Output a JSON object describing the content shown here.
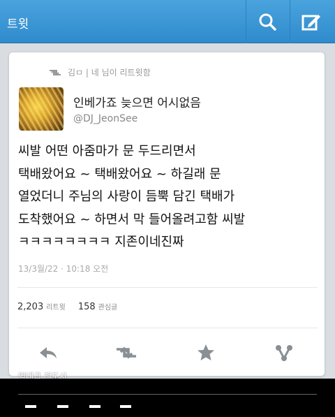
{
  "header": {
    "title": "트윗",
    "search_icon": "search-icon",
    "compose_icon": "compose-icon"
  },
  "tweet": {
    "retweeted_by": "김ㅁ | 네 님이 리트윗함",
    "author": {
      "name": "인베가죠 늦으면 어시없음",
      "handle": "@DJ_JeonSee"
    },
    "text": "씨발 어떤 아줌마가 문 두드리면서\n택배왔어요 ~ 택배왔어요 ~ 하길래 문\n열었더니 주님의 사랑이 듬뿍 담긴 택배가\n도착했어요 ~ 하면서 막 들어올려고함 씨발\nㅋㅋㅋㅋㅋㅋㅋㅋ 지존이네진짜",
    "timestamp": "13/3월/22 · 10:18 오전",
    "retweets": {
      "count": "2,203",
      "label": "리트윗"
    },
    "favorites": {
      "count": "158",
      "label": "관심글"
    }
  },
  "actions": {
    "reply_icon": "reply-icon",
    "retweet_icon": "retweet-icon",
    "favorite_icon": "star-icon",
    "share_icon": "share-icon"
  },
  "watermark": "역대급 전도사",
  "colors": {
    "header_bg": "#3596d6",
    "card_bg": "#ffffff",
    "page_bg": "#d9dde1",
    "icon_gray": "#8a8f94"
  }
}
